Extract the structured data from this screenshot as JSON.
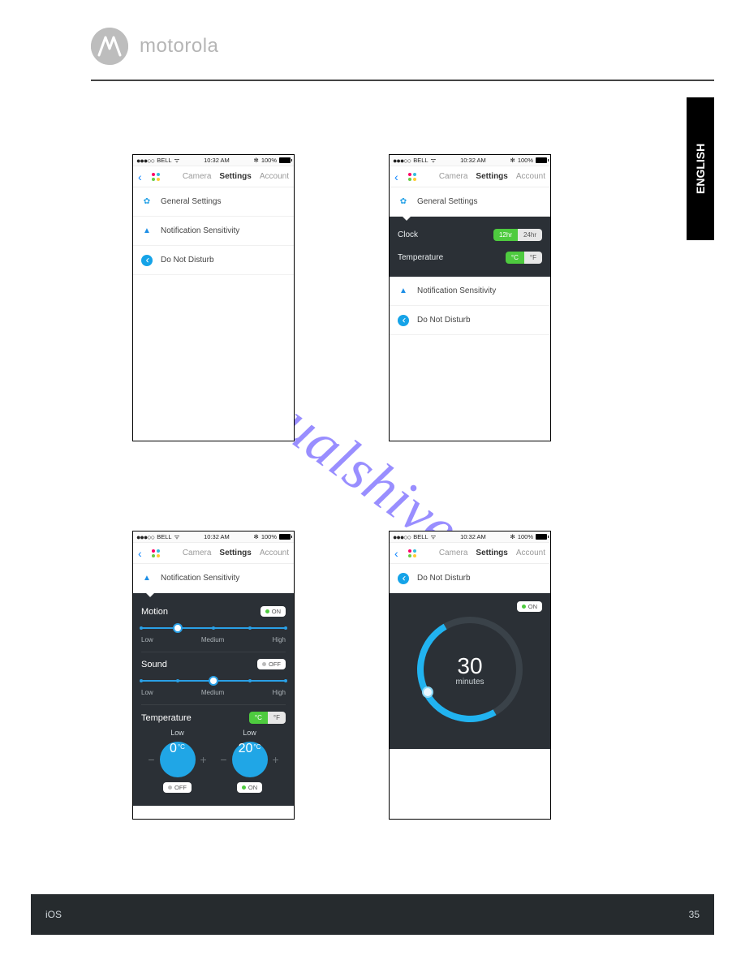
{
  "brand": {
    "name": "motorola"
  },
  "side_tab": "ENGLISH",
  "watermark": "Manualshive.com",
  "statusbar": {
    "carrier": "BELL",
    "signal": "●●●○○",
    "time": "10:32 AM",
    "bluetooth": "✻",
    "battery": "100%"
  },
  "nav": {
    "tabs": {
      "camera": "Camera",
      "settings": "Settings",
      "account": "Account"
    }
  },
  "settings_list": {
    "general": "General Settings",
    "notification": "Notification Sensitivity",
    "dnd": "Do Not Disturb"
  },
  "general_panel": {
    "clock": {
      "label": "Clock",
      "opt1": "12hr",
      "opt2": "24hr"
    },
    "temperature": {
      "label": "Temperature",
      "opt1": "°C",
      "opt2": "°F"
    }
  },
  "notif_panel": {
    "motion": {
      "label": "Motion",
      "toggle": "ON"
    },
    "sound": {
      "label": "Sound",
      "toggle": "OFF"
    },
    "scale": {
      "low": "Low",
      "medium": "Medium",
      "high": "High"
    },
    "temperature": {
      "label": "Temperature",
      "unit_c": "°C",
      "unit_f": "°F",
      "low": {
        "label": "Low",
        "value": "0",
        "unit": "°C",
        "toggle": "OFF"
      },
      "high": {
        "label": "Low",
        "value": "20",
        "unit": "°C",
        "toggle": "ON"
      }
    }
  },
  "dnd_panel": {
    "toggle": "ON",
    "value": "30",
    "unit": "minutes"
  },
  "footer": {
    "left": "iOS",
    "right": "35"
  }
}
